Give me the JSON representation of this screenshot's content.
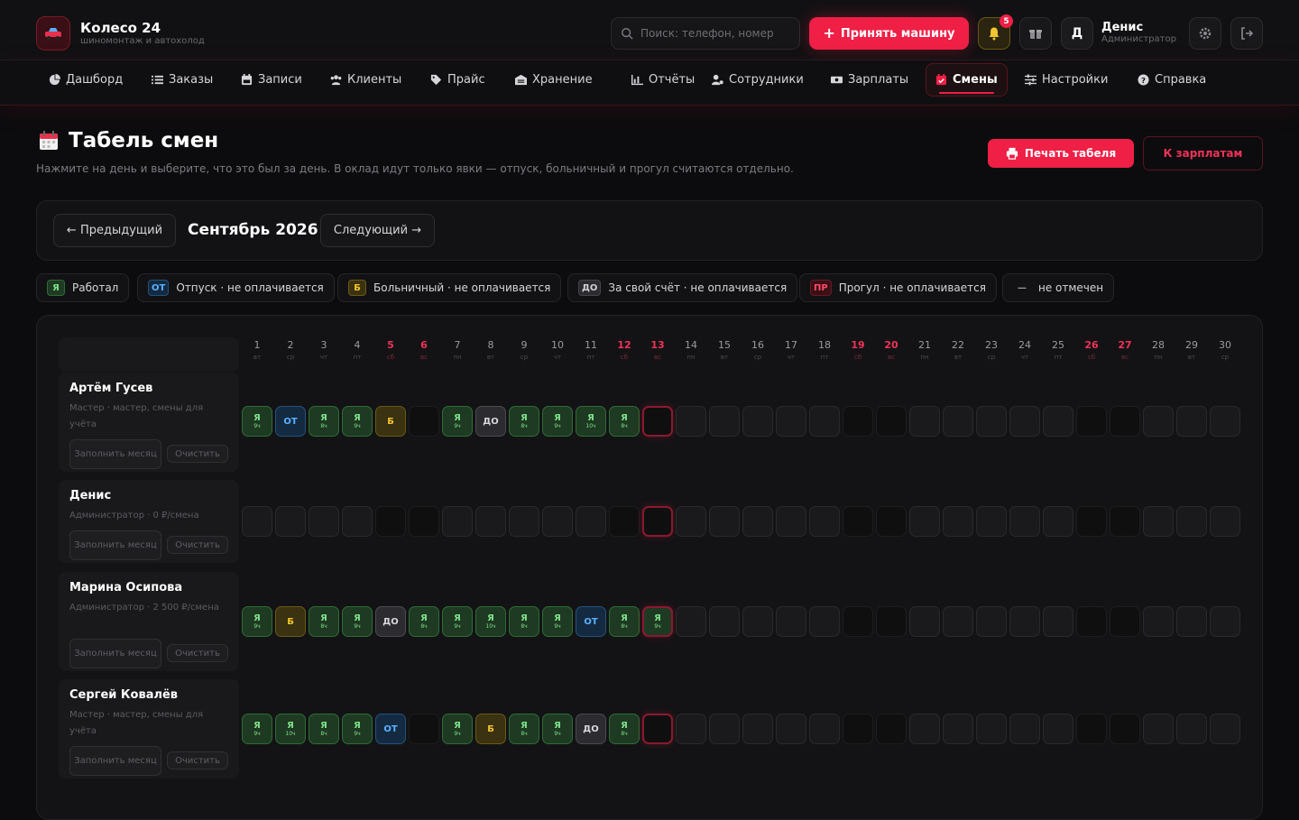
{
  "brand": {
    "title": "Колесо 24",
    "subtitle": "шиномонтаж и автохолод"
  },
  "header": {
    "search_placeholder": "Поиск: телефон, номер",
    "accept_label": "Принять машину",
    "notifications_count": "5",
    "avatar_letter": "Д",
    "user_name": "Денис",
    "user_role": "Администратор"
  },
  "nav": [
    {
      "label": "Дашборд",
      "icon": "pie-chart-icon"
    },
    {
      "label": "Заказы",
      "icon": "list-icon"
    },
    {
      "label": "Записи",
      "icon": "calendar-icon"
    },
    {
      "label": "Клиенты",
      "icon": "users-icon"
    },
    {
      "label": "Прайс",
      "icon": "tag-icon"
    },
    {
      "label": "Хранение",
      "icon": "warehouse-icon"
    },
    {
      "label": "Отчёты",
      "icon": "chart-icon"
    },
    {
      "label": "Сотрудники",
      "icon": "user-gear-icon"
    },
    {
      "label": "Зарплаты",
      "icon": "money-icon"
    },
    {
      "label": "Смены",
      "icon": "calendar-check-icon",
      "active": true
    },
    {
      "label": "Настройки",
      "icon": "sliders-icon"
    },
    {
      "label": "Справка",
      "icon": "help-icon"
    }
  ],
  "page": {
    "title": "Табель смен",
    "description": "Нажмите на день и выберите, что это был за день. В оклад идут только явки — отпуск, больничный и прогул считаются отдельно.",
    "print_label": "Печать табеля",
    "salary_label": "К зарплатам"
  },
  "month": {
    "prev_label": "← Предыдущий",
    "current": "Сентябрь 2026",
    "next_label": "Следующий →"
  },
  "legend": [
    {
      "code": "Я",
      "label": "Работал",
      "kind": "work"
    },
    {
      "code": "ОТ",
      "label": "Отпуск · не оплачивается",
      "kind": "vac"
    },
    {
      "code": "Б",
      "label": "Больничный · не оплачивается",
      "kind": "sick"
    },
    {
      "code": "ДО",
      "label": "За свой счёт · не оплачивается",
      "kind": "own"
    },
    {
      "code": "ПР",
      "label": "Прогул · не оплачивается",
      "kind": "abs"
    },
    {
      "code": "—",
      "label": "не отмечен",
      "kind": "none"
    }
  ],
  "days": [
    {
      "n": "1",
      "d": "вт"
    },
    {
      "n": "2",
      "d": "ср"
    },
    {
      "n": "3",
      "d": "чт"
    },
    {
      "n": "4",
      "d": "пт"
    },
    {
      "n": "5",
      "d": "сб",
      "we": true
    },
    {
      "n": "6",
      "d": "вс",
      "we": true
    },
    {
      "n": "7",
      "d": "пн"
    },
    {
      "n": "8",
      "d": "вт"
    },
    {
      "n": "9",
      "d": "ср"
    },
    {
      "n": "10",
      "d": "чт"
    },
    {
      "n": "11",
      "d": "пт"
    },
    {
      "n": "12",
      "d": "сб",
      "we": true
    },
    {
      "n": "13",
      "d": "вс",
      "we": true
    },
    {
      "n": "14",
      "d": "пн"
    },
    {
      "n": "15",
      "d": "вт"
    },
    {
      "n": "16",
      "d": "ср"
    },
    {
      "n": "17",
      "d": "чт"
    },
    {
      "n": "18",
      "d": "пт"
    },
    {
      "n": "19",
      "d": "сб",
      "we": true
    },
    {
      "n": "20",
      "d": "вс",
      "we": true
    },
    {
      "n": "21",
      "d": "пн"
    },
    {
      "n": "22",
      "d": "вт"
    },
    {
      "n": "23",
      "d": "ср"
    },
    {
      "n": "24",
      "d": "чт"
    },
    {
      "n": "25",
      "d": "пт"
    },
    {
      "n": "26",
      "d": "сб",
      "we": true
    },
    {
      "n": "27",
      "d": "вс",
      "we": true
    },
    {
      "n": "28",
      "d": "пн"
    },
    {
      "n": "29",
      "d": "вт"
    },
    {
      "n": "30",
      "d": "ср"
    }
  ],
  "today_index": 12,
  "row_labels": {
    "fill": "Заполнить месяц",
    "clear": "Очистить"
  },
  "employees": [
    {
      "name": "Артём Гусев",
      "meta": "Мастер · мастер, смены для учёта",
      "cells": [
        [
          "work",
          "Я",
          "9ч"
        ],
        [
          "vac",
          "ОТ",
          ""
        ],
        [
          "work",
          "Я",
          "8ч"
        ],
        [
          "work",
          "Я",
          "9ч"
        ],
        [
          "sick",
          "Б",
          ""
        ],
        [
          "empty"
        ],
        [
          "work",
          "Я",
          "9ч"
        ],
        [
          "own",
          "ДО",
          ""
        ],
        [
          "work",
          "Я",
          "8ч"
        ],
        [
          "work",
          "Я",
          "9ч"
        ],
        [
          "work",
          "Я",
          "10ч"
        ],
        [
          "work",
          "Я",
          "8ч"
        ],
        [
          "empty"
        ]
      ]
    },
    {
      "name": "Денис",
      "meta": "Администратор · 0 ₽/смена",
      "cells": []
    },
    {
      "name": "Марина Осипова",
      "meta": "Администратор · 2 500 ₽/смена",
      "cells": [
        [
          "work",
          "Я",
          "9ч"
        ],
        [
          "sick",
          "Б",
          ""
        ],
        [
          "work",
          "Я",
          "8ч"
        ],
        [
          "work",
          "Я",
          "9ч"
        ],
        [
          "own",
          "ДО",
          ""
        ],
        [
          "work",
          "Я",
          "8ч"
        ],
        [
          "work",
          "Я",
          "9ч"
        ],
        [
          "work",
          "Я",
          "10ч"
        ],
        [
          "work",
          "Я",
          "8ч"
        ],
        [
          "work",
          "Я",
          "9ч"
        ],
        [
          "vac",
          "ОТ",
          ""
        ],
        [
          "work",
          "Я",
          "8ч"
        ],
        [
          "work",
          "Я",
          "9ч"
        ]
      ]
    },
    {
      "name": "Сергей Ковалёв",
      "meta": "Мастер · мастер, смены для учёта",
      "cells": [
        [
          "work",
          "Я",
          "9ч"
        ],
        [
          "work",
          "Я",
          "10ч"
        ],
        [
          "work",
          "Я",
          "8ч"
        ],
        [
          "work",
          "Я",
          "9ч"
        ],
        [
          "vac",
          "ОТ",
          ""
        ],
        [
          "empty"
        ],
        [
          "work",
          "Я",
          "9ч"
        ],
        [
          "sick",
          "Б",
          ""
        ],
        [
          "work",
          "Я",
          "8ч"
        ],
        [
          "work",
          "Я",
          "9ч"
        ],
        [
          "own",
          "ДО",
          ""
        ],
        [
          "work",
          "Я",
          "8ч"
        ],
        [
          "empty"
        ]
      ]
    }
  ],
  "colors": {
    "accent": "#ef1f46",
    "work": "#7fe08a",
    "vacation": "#5ab0ff",
    "sick": "#f2c530"
  }
}
